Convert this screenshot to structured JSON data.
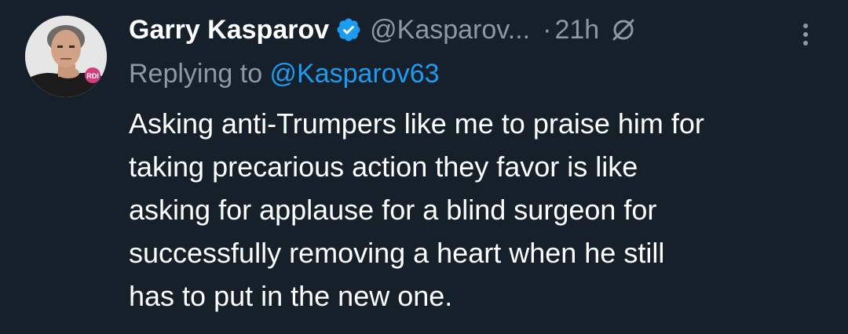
{
  "tweet": {
    "display_name": "Garry Kasparov",
    "handle": "@Kasparov...",
    "separator": "·",
    "time": "21h",
    "replying_prefix": "Replying to ",
    "replying_handle": "@Kasparov63",
    "avatar_badge": "RDI",
    "text_lines": [
      "Asking anti-Trumpers like me to praise him for",
      "taking precarious action they favor is like",
      "asking for applause for a blind surgeon for",
      "successfully removing a heart when he still",
      "has to put in the new one."
    ]
  },
  "icons": {
    "verified": "verified-badge-icon",
    "grok": "grok-icon",
    "more": "more-options-icon"
  },
  "colors": {
    "background": "#15202b",
    "secondary_text": "#8b98a5",
    "link": "#1d9bf0",
    "verified": "#1d9bf0"
  }
}
